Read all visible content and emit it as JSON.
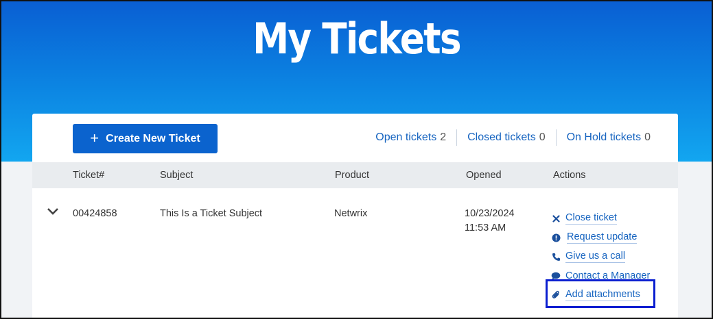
{
  "hero": {
    "title": "My Tickets"
  },
  "toolbar": {
    "create_label": "Create New Ticket",
    "counters": [
      {
        "label": "Open tickets",
        "count": "2"
      },
      {
        "label": "Closed tickets",
        "count": "0"
      },
      {
        "label": "On Hold tickets",
        "count": "0"
      }
    ]
  },
  "table": {
    "headers": [
      "Ticket#",
      "Subject",
      "Product",
      "Opened",
      "Actions"
    ],
    "rows": [
      {
        "ticket": "00424858",
        "subject": "This Is a Ticket Subject",
        "product": "Netwrix",
        "opened_date": "10/23/2024",
        "opened_time": "11:53 AM",
        "actions": [
          {
            "label": "Close ticket",
            "icon": "close-icon"
          },
          {
            "label": "Request update",
            "icon": "alert-icon"
          },
          {
            "label": "Give us a call",
            "icon": "phone-icon"
          },
          {
            "label": "Contact a Manager",
            "icon": "chat-icon"
          },
          {
            "label": "Add attachments",
            "icon": "paperclip-icon"
          }
        ]
      }
    ]
  },
  "colors": {
    "accent": "#0b63ce",
    "link": "#1664c0",
    "highlight": "#0b1fd0"
  }
}
